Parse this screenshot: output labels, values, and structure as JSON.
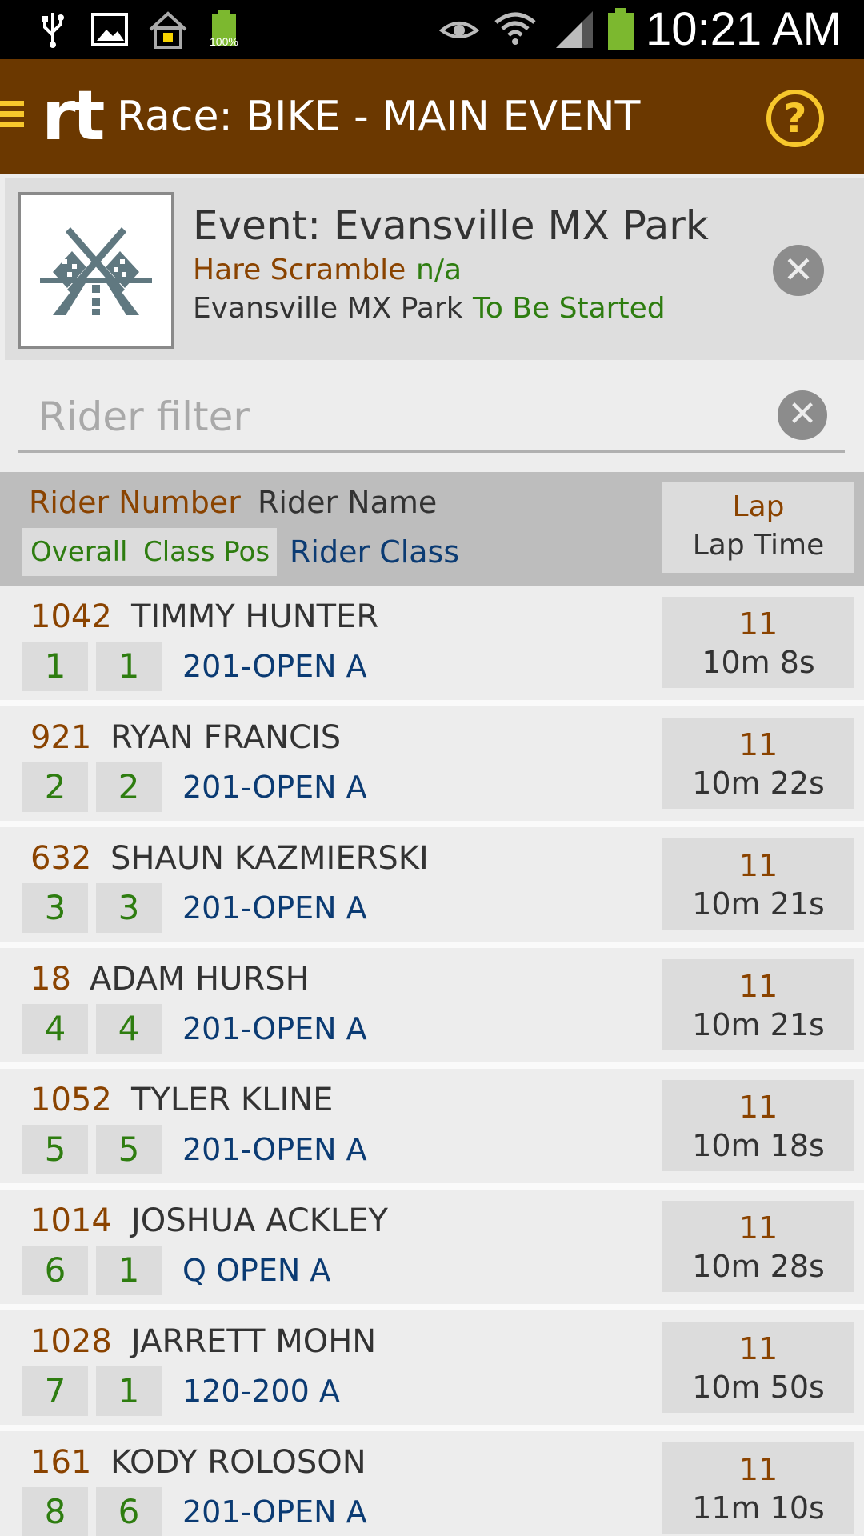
{
  "status_bar": {
    "time": "10:21 AM",
    "battery_percent": "100%",
    "icons": [
      "usb-icon",
      "image-icon",
      "home-icon",
      "battery-notification-icon",
      "eye-icon",
      "wifi-icon",
      "signal-icon",
      "battery-icon"
    ]
  },
  "action_bar": {
    "logo": "rt",
    "title": "Race: BIKE - MAIN EVENT",
    "help": "?"
  },
  "event": {
    "title": "Event: Evansville MX Park",
    "type": "Hare Scramble",
    "type_value": "n/a",
    "venue": "Evansville MX Park",
    "status": "To Be Started",
    "close": "✕"
  },
  "filter": {
    "placeholder": "Rider filter",
    "value": "",
    "clear": "✕"
  },
  "header": {
    "rider_number": "Rider Number",
    "rider_name": "Rider Name",
    "overall": "Overall",
    "class_pos": "Class Pos",
    "rider_class": "Rider Class",
    "lap": "Lap",
    "lap_time": "Lap Time"
  },
  "rows": [
    {
      "number": "1042",
      "name": "TIMMY HUNTER",
      "overall": "1",
      "class_pos": "1",
      "class": "201-OPEN A",
      "lap": "11",
      "lap_time": "10m 8s"
    },
    {
      "number": "921",
      "name": "RYAN FRANCIS",
      "overall": "2",
      "class_pos": "2",
      "class": "201-OPEN A",
      "lap": "11",
      "lap_time": "10m 22s"
    },
    {
      "number": "632",
      "name": "SHAUN KAZMIERSKI",
      "overall": "3",
      "class_pos": "3",
      "class": "201-OPEN A",
      "lap": "11",
      "lap_time": "10m 21s"
    },
    {
      "number": "18",
      "name": "ADAM HURSH",
      "overall": "4",
      "class_pos": "4",
      "class": "201-OPEN A",
      "lap": "11",
      "lap_time": "10m 21s"
    },
    {
      "number": "1052",
      "name": "TYLER KLINE",
      "overall": "5",
      "class_pos": "5",
      "class": "201-OPEN A",
      "lap": "11",
      "lap_time": "10m 18s"
    },
    {
      "number": "1014",
      "name": "JOSHUA ACKLEY",
      "overall": "6",
      "class_pos": "1",
      "class": "Q OPEN A",
      "lap": "11",
      "lap_time": "10m 28s"
    },
    {
      "number": "1028",
      "name": "JARRETT MOHN",
      "overall": "7",
      "class_pos": "1",
      "class": "120-200 A",
      "lap": "11",
      "lap_time": "10m 50s"
    },
    {
      "number": "161",
      "name": "KODY ROLOSON",
      "overall": "8",
      "class_pos": "6",
      "class": "201-OPEN A",
      "lap": "11",
      "lap_time": "11m 10s"
    }
  ]
}
